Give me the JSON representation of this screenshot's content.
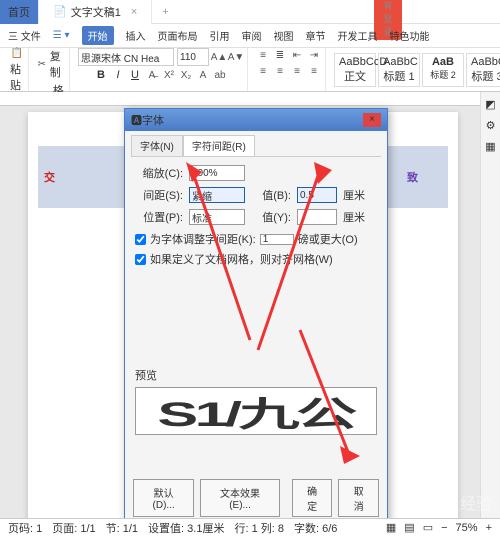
{
  "titlebar": {
    "home": "首页",
    "doc": "文字文稿1",
    "login": "没有登录"
  },
  "menubar": {
    "file": "三 文件",
    "drop": "☰ ▾",
    "start": "开始",
    "insert": "插入",
    "layout": "页面布局",
    "ref": "引用",
    "review": "审阅",
    "view": "视图",
    "section": "章节",
    "dev": "开发工具",
    "special": "特色功能"
  },
  "toolbar": {
    "paste": "粘贴",
    "copy": "复制",
    "format": "格式刷",
    "font": "思源宋体 CN Hea",
    "size": "110",
    "styles": [
      {
        "t": "AaBbCcD",
        "s": "正文"
      },
      {
        "t": "AaBbC",
        "s": "标题 1"
      },
      {
        "t": "AaB",
        "s": "标题 2"
      },
      {
        "t": "AaBbC",
        "s": "标题 3"
      }
    ]
  },
  "canvas": {
    "text1": "交",
    "text2": "致"
  },
  "dialog": {
    "title": "字体",
    "tab1": "字体(N)",
    "tab2": "字符间距(R)",
    "scale_l": "缩放(C):",
    "scale_v": "100%",
    "spacing_l": "间距(S):",
    "spacing_v": "紧缩",
    "spacing_val_l": "值(B):",
    "spacing_val": "0.5",
    "spacing_unit": "厘米",
    "pos_l": "位置(P):",
    "pos_v": "标准",
    "pos_val_l": "值(Y):",
    "pos_unit": "厘米",
    "kern": "为字体调整字间距(K):",
    "kern_v": "1",
    "kern_unit": "磅或更大(O)",
    "snap": "如果定义了文档网格，则对齐网格(W)",
    "preview_l": "预览",
    "preview_t": "S1/九公",
    "btn_default": "默认(D)...",
    "btn_effect": "文本效果(E)...",
    "btn_ok": "确定",
    "btn_cancel": "取消"
  },
  "status": {
    "page": "页码: 1",
    "pages": "页面: 1/1",
    "section": "节: 1/1",
    "cursor": "设置值: 3.1厘米",
    "col": "行: 1  列: 8",
    "chars": "字数: 6/6",
    "zoom": "75%"
  },
  "watermark": "Baidu 经验"
}
